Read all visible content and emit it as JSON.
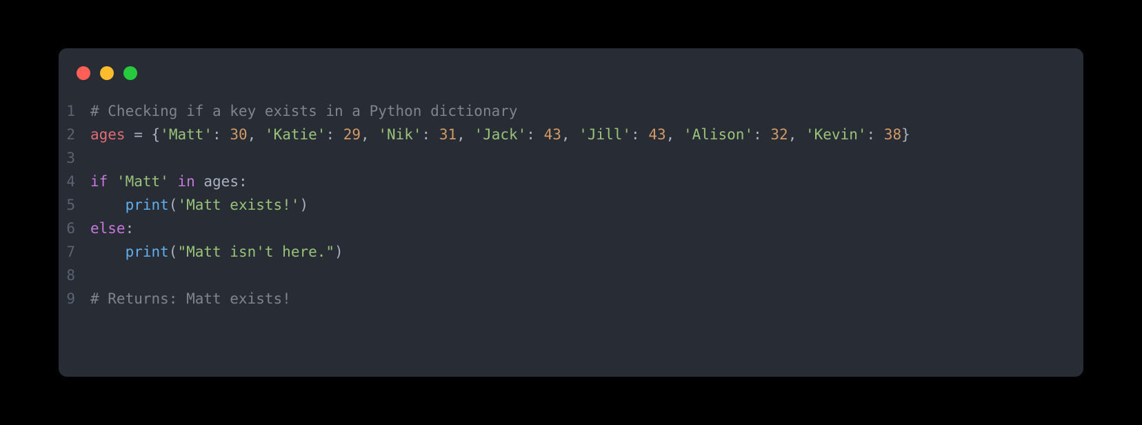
{
  "colors": {
    "background": "#000000",
    "panel": "#282c34",
    "gutter": "#5c6370",
    "default": "#abb2bf",
    "comment": "#7f848e",
    "keyword": "#c678dd",
    "string": "#98c379",
    "number": "#d19a66",
    "builtin": "#61afef",
    "red": "#e06c75",
    "traffic_red": "#ff5f56",
    "traffic_yellow": "#ffbd2e",
    "traffic_green": "#27c93f"
  },
  "code": {
    "language": "python",
    "lines": [
      {
        "n": 1,
        "tokens": [
          {
            "t": "# Checking if a key exists in a Python dictionary",
            "c": "comment"
          }
        ]
      },
      {
        "n": 2,
        "tokens": [
          {
            "t": "ages ",
            "c": "red"
          },
          {
            "t": "= ",
            "c": "op"
          },
          {
            "t": "{",
            "c": "punct"
          },
          {
            "t": "'Matt'",
            "c": "string"
          },
          {
            "t": ": ",
            "c": "punct"
          },
          {
            "t": "30",
            "c": "number"
          },
          {
            "t": ", ",
            "c": "punct"
          },
          {
            "t": "'Katie'",
            "c": "string"
          },
          {
            "t": ": ",
            "c": "punct"
          },
          {
            "t": "29",
            "c": "number"
          },
          {
            "t": ", ",
            "c": "punct"
          },
          {
            "t": "'Nik'",
            "c": "string"
          },
          {
            "t": ": ",
            "c": "punct"
          },
          {
            "t": "31",
            "c": "number"
          },
          {
            "t": ", ",
            "c": "punct"
          },
          {
            "t": "'Jack'",
            "c": "string"
          },
          {
            "t": ": ",
            "c": "punct"
          },
          {
            "t": "43",
            "c": "number"
          },
          {
            "t": ", ",
            "c": "punct"
          },
          {
            "t": "'Jill'",
            "c": "string"
          },
          {
            "t": ": ",
            "c": "punct"
          },
          {
            "t": "43",
            "c": "number"
          },
          {
            "t": ", ",
            "c": "punct"
          },
          {
            "t": "'Alison'",
            "c": "string"
          },
          {
            "t": ": ",
            "c": "punct"
          },
          {
            "t": "32",
            "c": "number"
          },
          {
            "t": ", ",
            "c": "punct"
          },
          {
            "t": "'Kevin'",
            "c": "string"
          },
          {
            "t": ": ",
            "c": "punct"
          },
          {
            "t": "38",
            "c": "number"
          },
          {
            "t": "}",
            "c": "punct"
          }
        ]
      },
      {
        "n": 3,
        "tokens": []
      },
      {
        "n": 4,
        "tokens": [
          {
            "t": "if ",
            "c": "keyword"
          },
          {
            "t": "'Matt'",
            "c": "string"
          },
          {
            "t": " ",
            "c": "punct"
          },
          {
            "t": "in",
            "c": "keyword"
          },
          {
            "t": " ages:",
            "c": "ident"
          }
        ]
      },
      {
        "n": 5,
        "tokens": [
          {
            "t": "    ",
            "c": "punct"
          },
          {
            "t": "print",
            "c": "builtin"
          },
          {
            "t": "(",
            "c": "punct"
          },
          {
            "t": "'Matt exists!'",
            "c": "string"
          },
          {
            "t": ")",
            "c": "punct"
          }
        ]
      },
      {
        "n": 6,
        "tokens": [
          {
            "t": "else",
            "c": "keyword"
          },
          {
            "t": ":",
            "c": "punct"
          }
        ]
      },
      {
        "n": 7,
        "tokens": [
          {
            "t": "    ",
            "c": "punct"
          },
          {
            "t": "print",
            "c": "builtin"
          },
          {
            "t": "(",
            "c": "punct"
          },
          {
            "t": "\"Matt isn't here.\"",
            "c": "string"
          },
          {
            "t": ")",
            "c": "punct"
          }
        ]
      },
      {
        "n": 8,
        "tokens": []
      },
      {
        "n": 9,
        "tokens": [
          {
            "t": "# Returns: Matt exists!",
            "c": "comment"
          }
        ]
      }
    ]
  }
}
